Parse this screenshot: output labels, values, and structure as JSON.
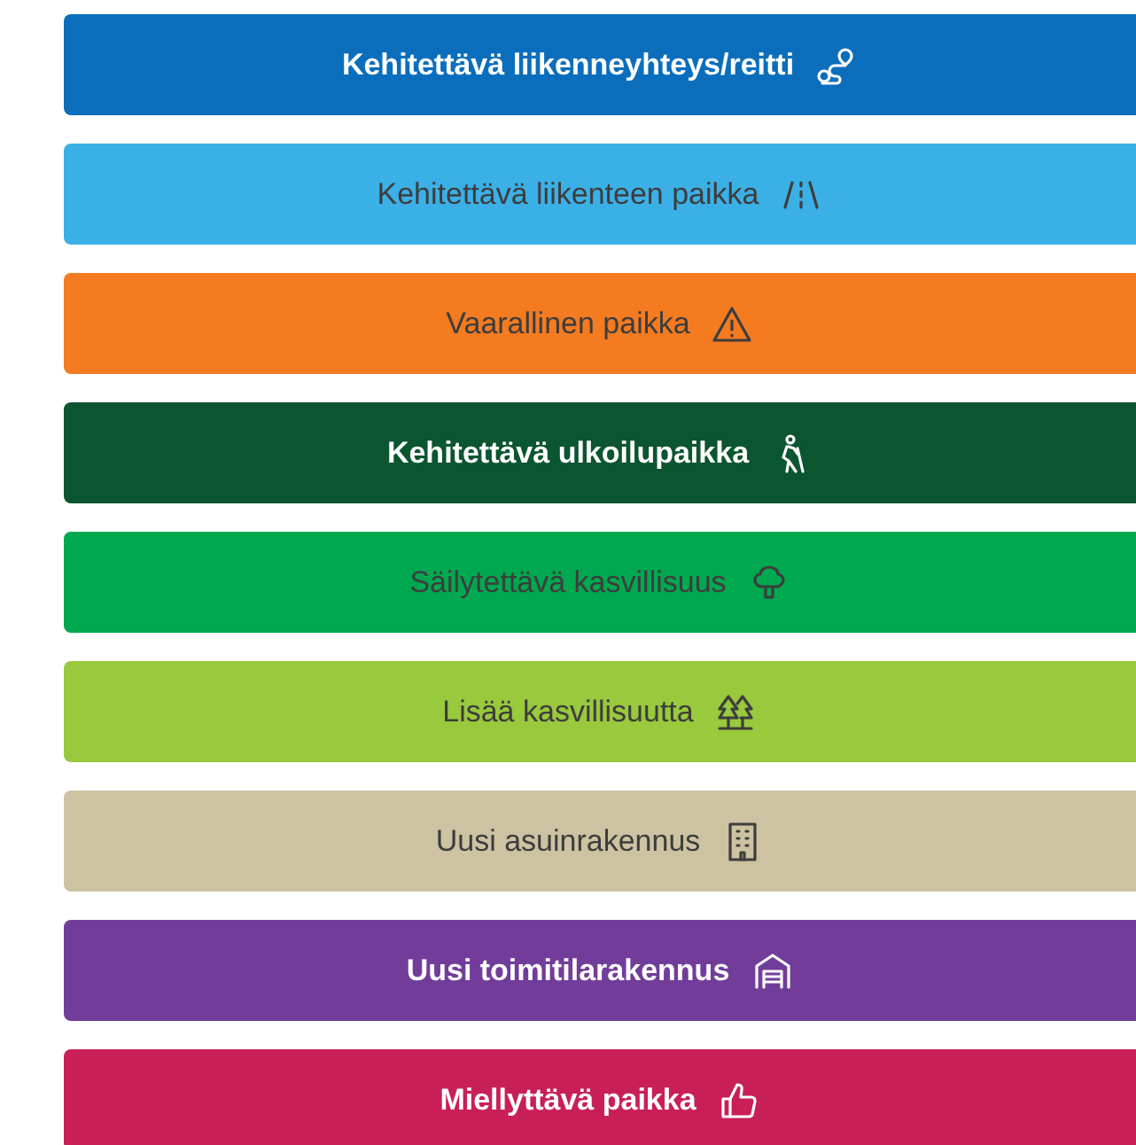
{
  "buttons": [
    {
      "label": "Kehitettävä liikenneyhteys/reitti",
      "kind": "route",
      "color": "#0a6ebd"
    },
    {
      "label": "Kehitettävä liikenteen paikka",
      "kind": "road",
      "color": "#3bb0e6"
    },
    {
      "label": "Vaarallinen paikka",
      "kind": "warning",
      "color": "#f47b20"
    },
    {
      "label": "Kehitettävä ulkoilupaikka",
      "kind": "hiker",
      "color": "#0b5530"
    },
    {
      "label": "Säilytettävä kasvillisuus",
      "kind": "tree",
      "color": "#00a850"
    },
    {
      "label": "Lisää kasvillisuutta",
      "kind": "trees",
      "color": "#99c93c"
    },
    {
      "label": "Uusi asuinrakennus",
      "kind": "building",
      "color": "#cdc2a1"
    },
    {
      "label": "Uusi toimitilarakennus",
      "kind": "garage",
      "color": "#723d9a"
    },
    {
      "label": "Miellyttävä paikka",
      "kind": "thumb",
      "color": "#c91f57"
    }
  ]
}
